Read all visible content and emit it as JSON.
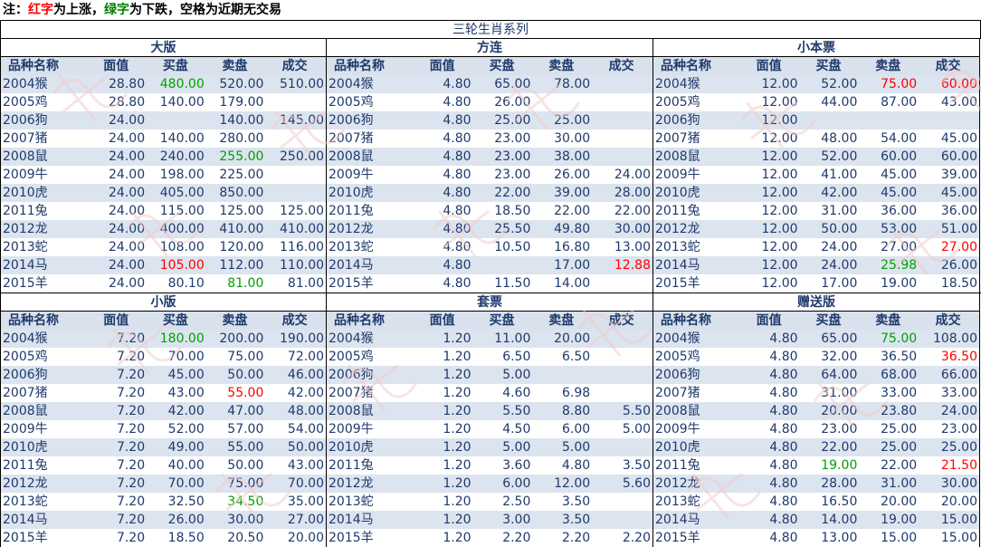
{
  "note": {
    "prefix": "注：",
    "red_word": "红字",
    "mid1": "为上涨，",
    "green_word": "绿字",
    "mid2": "为下跌，空格为近期无交易"
  },
  "title": "三轮生肖系列",
  "columns": [
    "品种名称",
    "面值",
    "买盘",
    "卖盘",
    "成交"
  ],
  "colors": {
    "up": "#ff0000",
    "down": "#00a000",
    "text": "#1f3a6b",
    "alt_row": "#dce4ef"
  },
  "sections": [
    {
      "name": "大版",
      "rows": [
        [
          "2004猴",
          "28.80",
          "480.00|d",
          "520.00",
          "510.00"
        ],
        [
          "2005鸡",
          "28.80",
          "140.00",
          "179.00",
          ""
        ],
        [
          "2006狗",
          "24.00",
          "",
          "140.00",
          "145.00"
        ],
        [
          "2007猪",
          "24.00",
          "140.00",
          "280.00",
          ""
        ],
        [
          "2008鼠",
          "24.00",
          "240.00",
          "255.00|d",
          "250.00"
        ],
        [
          "2009牛",
          "24.00",
          "198.00",
          "225.00",
          ""
        ],
        [
          "2010虎",
          "24.00",
          "405.00",
          "850.00",
          ""
        ],
        [
          "2011兔",
          "24.00",
          "115.00",
          "125.00",
          "125.00"
        ],
        [
          "2012龙",
          "24.00",
          "400.00",
          "410.00",
          "410.00"
        ],
        [
          "2013蛇",
          "24.00",
          "108.00",
          "120.00",
          "116.00"
        ],
        [
          "2014马",
          "24.00",
          "105.00|u",
          "112.00",
          "110.00"
        ],
        [
          "2015羊",
          "24.00",
          "80.10",
          "81.00|d",
          "81.00"
        ]
      ]
    },
    {
      "name": "方连",
      "rows": [
        [
          "2004猴",
          "4.80",
          "65.00",
          "78.00",
          ""
        ],
        [
          "2005鸡",
          "4.80",
          "26.00",
          "",
          ""
        ],
        [
          "2006狗",
          "4.80",
          "25.00",
          "25.00",
          ""
        ],
        [
          "2007猪",
          "4.80",
          "23.00",
          "30.00",
          ""
        ],
        [
          "2008鼠",
          "4.80",
          "23.00",
          "38.00",
          ""
        ],
        [
          "2009牛",
          "4.80",
          "23.00",
          "26.00",
          "24.00"
        ],
        [
          "2010虎",
          "4.80",
          "22.00",
          "39.00",
          "28.00"
        ],
        [
          "2011兔",
          "4.80",
          "18.50",
          "22.00",
          "22.00"
        ],
        [
          "2012龙",
          "4.80",
          "25.50",
          "49.80",
          "30.00"
        ],
        [
          "2013蛇",
          "4.80",
          "10.50",
          "16.80",
          "13.00"
        ],
        [
          "2014马",
          "4.80",
          "",
          "17.00",
          "12.88|u"
        ],
        [
          "2015羊",
          "4.80",
          "11.50",
          "14.00",
          ""
        ]
      ]
    },
    {
      "name": "小本票",
      "rows": [
        [
          "2004猴",
          "12.00",
          "52.00",
          "75.00|u",
          "60.00|u"
        ],
        [
          "2005鸡",
          "12.00",
          "44.00",
          "87.00",
          "43.00"
        ],
        [
          "2006狗",
          "12.00",
          "",
          "",
          ""
        ],
        [
          "2007猪",
          "12.00",
          "48.00",
          "54.00",
          "45.00"
        ],
        [
          "2008鼠",
          "12.00",
          "52.00",
          "60.00",
          "60.00"
        ],
        [
          "2009牛",
          "12.00",
          "41.00",
          "45.00",
          "39.00"
        ],
        [
          "2010虎",
          "12.00",
          "42.00",
          "45.00",
          "45.00"
        ],
        [
          "2011兔",
          "12.00",
          "31.00",
          "36.00",
          "36.00"
        ],
        [
          "2012龙",
          "12.00",
          "50.00",
          "53.00",
          "51.00"
        ],
        [
          "2013蛇",
          "12.00",
          "24.00",
          "27.00",
          "27.00|u"
        ],
        [
          "2014马",
          "12.00",
          "24.00",
          "25.98|d",
          "26.00"
        ],
        [
          "2015羊",
          "12.00",
          "17.00",
          "19.00",
          "18.50"
        ]
      ]
    },
    {
      "name": "小版",
      "rows": [
        [
          "2004猴",
          "7.20",
          "180.00|d",
          "200.00",
          "190.00"
        ],
        [
          "2005鸡",
          "7.20",
          "70.00",
          "75.00",
          "72.00"
        ],
        [
          "2006狗",
          "7.20",
          "45.00",
          "50.00",
          "46.00"
        ],
        [
          "2007猪",
          "7.20",
          "43.00",
          "55.00|u",
          "42.00"
        ],
        [
          "2008鼠",
          "7.20",
          "42.00",
          "47.00",
          "48.00"
        ],
        [
          "2009牛",
          "7.20",
          "52.00",
          "57.00",
          "54.00"
        ],
        [
          "2010虎",
          "7.20",
          "49.00",
          "55.00",
          "50.00"
        ],
        [
          "2011兔",
          "7.20",
          "40.00",
          "50.00",
          "43.00"
        ],
        [
          "2012龙",
          "7.20",
          "70.00",
          "75.00",
          "70.00"
        ],
        [
          "2013蛇",
          "7.20",
          "32.50",
          "34.50|d",
          "35.00"
        ],
        [
          "2014马",
          "7.20",
          "26.00",
          "30.00",
          "27.00"
        ],
        [
          "2015羊",
          "7.20",
          "18.50",
          "20.50",
          "20.00"
        ]
      ]
    },
    {
      "name": "套票",
      "rows": [
        [
          "2004猴",
          "1.20",
          "11.00",
          "20.00",
          ""
        ],
        [
          "2005鸡",
          "1.20",
          "6.50",
          "6.50",
          ""
        ],
        [
          "2006狗",
          "1.20",
          "5.00",
          "",
          ""
        ],
        [
          "2007猪",
          "1.20",
          "4.60",
          "6.98",
          ""
        ],
        [
          "2008鼠",
          "1.20",
          "5.50",
          "8.80",
          "5.50"
        ],
        [
          "2009牛",
          "1.20",
          "4.50",
          "6.00",
          "5.00"
        ],
        [
          "2010虎",
          "1.20",
          "5.00",
          "5.00",
          ""
        ],
        [
          "2011兔",
          "1.20",
          "3.60",
          "4.80",
          "3.50"
        ],
        [
          "2012龙",
          "1.20",
          "6.00",
          "12.00",
          "5.60"
        ],
        [
          "2013蛇",
          "1.20",
          "2.50",
          "3.50",
          ""
        ],
        [
          "2014马",
          "1.20",
          "3.00",
          "3.50",
          ""
        ],
        [
          "2015羊",
          "1.20",
          "2.20",
          "2.20",
          "2.20"
        ]
      ]
    },
    {
      "name": "赠送版",
      "rows": [
        [
          "2004猴",
          "4.80",
          "65.00",
          "75.00|d",
          "108.00"
        ],
        [
          "2005鸡",
          "4.80",
          "32.00",
          "36.50",
          "36.50|u"
        ],
        [
          "2006狗",
          "4.80",
          "64.00",
          "68.00",
          "66.00"
        ],
        [
          "2007猪",
          "4.80",
          "31.00",
          "33.00",
          "33.00"
        ],
        [
          "2008鼠",
          "4.80",
          "20.00",
          "23.80",
          "24.00"
        ],
        [
          "2009牛",
          "4.80",
          "23.00",
          "25.00",
          "23.00"
        ],
        [
          "2010虎",
          "4.80",
          "22.00",
          "25.00",
          "25.00"
        ],
        [
          "2011兔",
          "4.80",
          "19.00|d",
          "22.00",
          "21.50|u"
        ],
        [
          "2012龙",
          "4.80",
          "28.00",
          "31.00",
          "30.00"
        ],
        [
          "2013蛇",
          "4.80",
          "16.50",
          "20.00",
          "20.00"
        ],
        [
          "2014马",
          "4.80",
          "14.00",
          "19.00",
          "15.00"
        ],
        [
          "2015羊",
          "4.80",
          "13.00",
          "15.00",
          "15.00"
        ]
      ]
    }
  ]
}
